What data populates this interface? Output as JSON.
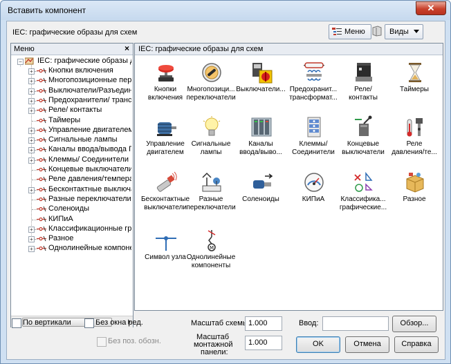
{
  "window": {
    "title": "Вставить компонент",
    "close_label": "✕"
  },
  "header": {
    "title": "IEC: графические образы для схем",
    "menu_btn": "Меню",
    "views_btn": "Виды"
  },
  "left_panel": {
    "title": "Меню",
    "close": "×",
    "root": "IEC: графические образы для схем",
    "items": [
      {
        "label": "Кнопки включения",
        "expandable": true
      },
      {
        "label": "Многопозиционные переключатели",
        "expandable": true
      },
      {
        "label": "Выключатели/Разъединители",
        "expandable": true
      },
      {
        "label": "Предохранители/ трансформаторы",
        "expandable": true
      },
      {
        "label": "Реле/ контакты",
        "expandable": true
      },
      {
        "label": "Таймеры",
        "expandable": false
      },
      {
        "label": "Управление двигателем",
        "expandable": true
      },
      {
        "label": "Сигнальные лампы",
        "expandable": true
      },
      {
        "label": "Каналы ввода/вывода ПЛК",
        "expandable": true
      },
      {
        "label": "Клеммы/ Соединители",
        "expandable": true
      },
      {
        "label": "Концевые выключатели",
        "expandable": false
      },
      {
        "label": "Реле давления/температуры",
        "expandable": false
      },
      {
        "label": "Бесконтактные выключатели",
        "expandable": true
      },
      {
        "label": "Разные переключатели",
        "expandable": false
      },
      {
        "label": "Соленоиды",
        "expandable": false
      },
      {
        "label": "КИПиА",
        "expandable": false
      },
      {
        "label": "Классификационные графические",
        "expandable": true
      },
      {
        "label": "Разное",
        "expandable": true
      },
      {
        "label": "Однолинейные компоненты",
        "expandable": true
      }
    ]
  },
  "right_panel": {
    "title": "IEC: графические образы для схем",
    "items": [
      {
        "icon": "pushbutton-icon",
        "line1": "Кнопки",
        "line2": "включения"
      },
      {
        "icon": "selector-switch-icon",
        "line1": "Многопозици...",
        "line2": "переключатели"
      },
      {
        "icon": "disconnect-switch-icon",
        "line1": "Выключатели...",
        "line2": ""
      },
      {
        "icon": "fuse-transformer-icon",
        "line1": "Предохранит...",
        "line2": "трансформат..."
      },
      {
        "icon": "relay-icon",
        "line1": "Реле/",
        "line2": "контакты"
      },
      {
        "icon": "hourglass-icon",
        "line1": "Таймеры",
        "line2": ""
      },
      {
        "icon": "motor-icon",
        "line1": "Управление",
        "line2": "двигателем"
      },
      {
        "icon": "lamp-icon",
        "line1": "Сигнальные",
        "line2": "лампы"
      },
      {
        "icon": "plc-io-icon",
        "line1": "Каналы",
        "line2": "ввода/выво..."
      },
      {
        "icon": "terminal-block-icon",
        "line1": "Клеммы/",
        "line2": "Соединители"
      },
      {
        "icon": "limit-switch-icon",
        "line1": "Концевые",
        "line2": "выключатели"
      },
      {
        "icon": "pressure-temp-icon",
        "line1": "Реле",
        "line2": "давления/те..."
      },
      {
        "icon": "proximity-switch-icon",
        "line1": "Бесконтактные",
        "line2": "выключатели"
      },
      {
        "icon": "misc-switch-icon",
        "line1": "Разные",
        "line2": "переключатели"
      },
      {
        "icon": "solenoid-icon",
        "line1": "Соленоиды",
        "line2": ""
      },
      {
        "icon": "gauge-icon",
        "line1": "КИПиА",
        "line2": ""
      },
      {
        "icon": "classification-icon",
        "line1": "Классифика...",
        "line2": "графические..."
      },
      {
        "icon": "misc-box-icon",
        "line1": "Разное",
        "line2": ""
      },
      {
        "icon": "node-symbol-icon",
        "line1": "Символ узла",
        "line2": ""
      },
      {
        "icon": "single-line-icon",
        "line1": "Однолинейные",
        "line2": "компоненты"
      }
    ]
  },
  "bottom": {
    "vertical": "По вертикали",
    "no_edit": "Без окна ред.",
    "no_pos": "Без поз. обозн.",
    "scale_schema_label": "Масштаб схемы:",
    "scale_schema_value": "1.000",
    "scale_panel_label_1": "Масштаб",
    "scale_panel_label_2": "монтажной",
    "scale_panel_label_3": "панели:",
    "scale_panel_value": "1.000",
    "input_label": "Ввод:",
    "input_value": "",
    "browse": "Обзор...",
    "ok": "OK",
    "cancel": "Отмена",
    "help": "Справка"
  },
  "colors": {
    "title_bar": "#c6d9ee",
    "close_button": "#c8412b",
    "panel_header": "#e8ecf2",
    "dialog_bg": "#f0f0f0"
  }
}
